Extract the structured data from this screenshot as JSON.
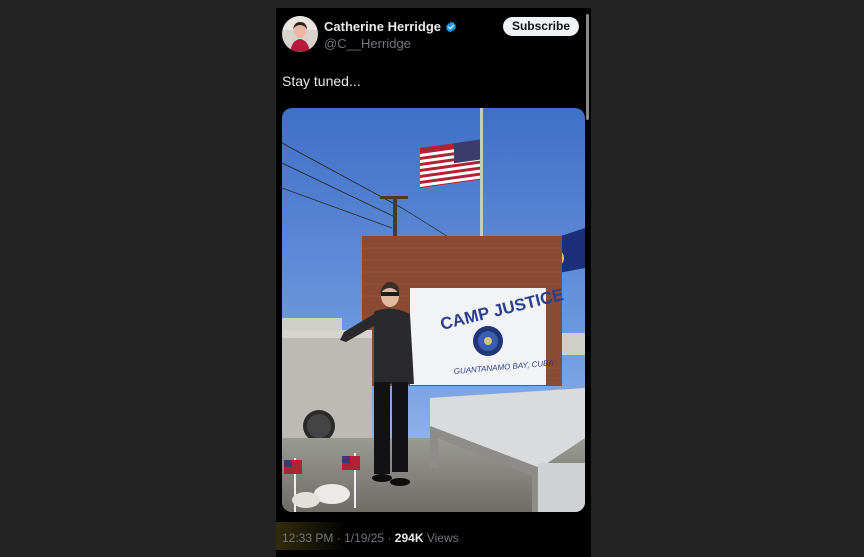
{
  "post": {
    "author": {
      "display_name": "Catherine Herridge",
      "handle": "@C__Herridge",
      "verified_icon": "verified-badge-icon"
    },
    "subscribe_label": "Subscribe",
    "text": "Stay tuned...",
    "media": {
      "sign_title": "CAMP JUSTICE",
      "sign_subtitle": "GUANTANAMO BAY, CUBA"
    },
    "meta": {
      "time": "12:33 PM",
      "separator": "·",
      "date": "1/19/25",
      "views_count": "294K",
      "views_label": "Views"
    }
  },
  "colors": {
    "background": "#000000",
    "text_primary": "#e7e9ea",
    "text_secondary": "#71767b",
    "verified_blue": "#1d9bf0",
    "subscribe_bg": "#eff3f4"
  }
}
